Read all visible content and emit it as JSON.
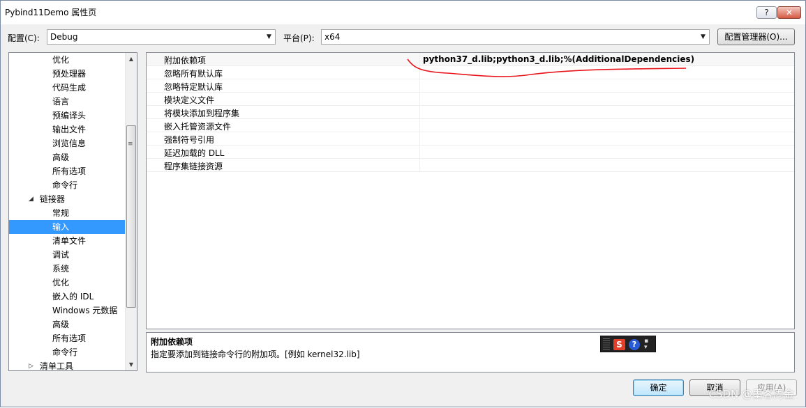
{
  "window": {
    "title": "Pybind11Demo 属性页",
    "help_label": "?",
    "close_label": "✕"
  },
  "toolbar": {
    "config_label": "配置(C):",
    "config_value": "Debug",
    "platform_label": "平台(P):",
    "platform_value": "x64",
    "config_manager_label": "配置管理器(O)..."
  },
  "tree": {
    "items": [
      {
        "label": "优化",
        "indent": 2,
        "selected": false
      },
      {
        "label": "预处理器",
        "indent": 2,
        "selected": false
      },
      {
        "label": "代码生成",
        "indent": 2,
        "selected": false
      },
      {
        "label": "语言",
        "indent": 2,
        "selected": false
      },
      {
        "label": "预编译头",
        "indent": 2,
        "selected": false
      },
      {
        "label": "输出文件",
        "indent": 2,
        "selected": false
      },
      {
        "label": "浏览信息",
        "indent": 2,
        "selected": false
      },
      {
        "label": "高级",
        "indent": 2,
        "selected": false
      },
      {
        "label": "所有选项",
        "indent": 2,
        "selected": false
      },
      {
        "label": "命令行",
        "indent": 2,
        "selected": false
      },
      {
        "label": "链接器",
        "indent": 1,
        "selected": false,
        "toggle": "◢"
      },
      {
        "label": "常规",
        "indent": 2,
        "selected": false
      },
      {
        "label": "输入",
        "indent": 2,
        "selected": true
      },
      {
        "label": "清单文件",
        "indent": 2,
        "selected": false
      },
      {
        "label": "调试",
        "indent": 2,
        "selected": false
      },
      {
        "label": "系统",
        "indent": 2,
        "selected": false
      },
      {
        "label": "优化",
        "indent": 2,
        "selected": false
      },
      {
        "label": "嵌入的 IDL",
        "indent": 2,
        "selected": false
      },
      {
        "label": "Windows 元数据",
        "indent": 2,
        "selected": false
      },
      {
        "label": "高级",
        "indent": 2,
        "selected": false
      },
      {
        "label": "所有选项",
        "indent": 2,
        "selected": false
      },
      {
        "label": "命令行",
        "indent": 2,
        "selected": false
      },
      {
        "label": "清单工具",
        "indent": 1,
        "selected": false,
        "toggle": "▷"
      }
    ]
  },
  "grid": {
    "rows": [
      {
        "name": "附加依赖项",
        "value": "python37_d.lib;python3_d.lib;%(AdditionalDependencies)"
      },
      {
        "name": "忽略所有默认库",
        "value": ""
      },
      {
        "name": "忽略特定默认库",
        "value": ""
      },
      {
        "name": "模块定义文件",
        "value": ""
      },
      {
        "name": "将模块添加到程序集",
        "value": ""
      },
      {
        "name": "嵌入托管资源文件",
        "value": ""
      },
      {
        "name": "强制符号引用",
        "value": ""
      },
      {
        "name": "延迟加载的 DLL",
        "value": ""
      },
      {
        "name": "程序集链接资源",
        "value": ""
      }
    ]
  },
  "description": {
    "title": "附加依赖项",
    "text": "指定要添加到链接命令行的附加项。[例如 kernel32.lib]"
  },
  "ime": {
    "s_label": "S",
    "help_label": "?"
  },
  "buttons": {
    "ok": "确定",
    "cancel": "取消",
    "apply": "应用(A)"
  },
  "watermark": "CSDN @墨客周金",
  "colors": {
    "selection": "#3399ff",
    "annotation": "#e8141c"
  }
}
